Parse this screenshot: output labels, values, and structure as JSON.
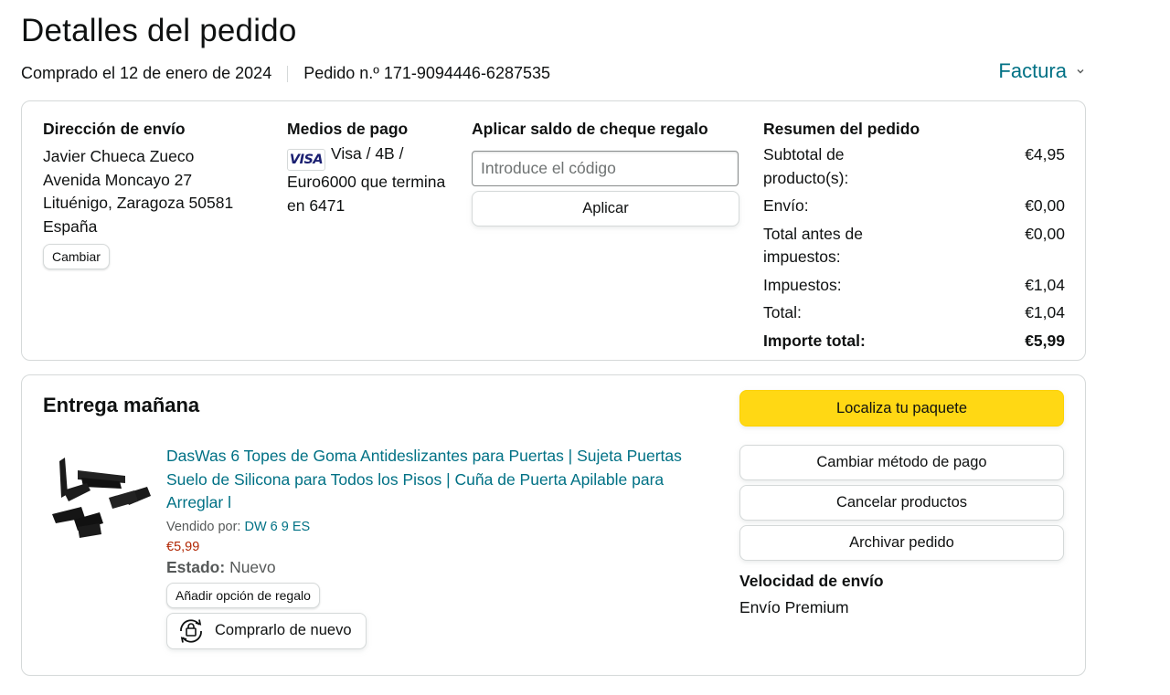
{
  "header": {
    "title": "Detalles del pedido",
    "purchase_date": "Comprado el 12 de enero de 2024",
    "order_number": "Pedido n.º 171-9094446-6287535",
    "invoice_label": "Factura"
  },
  "shipping": {
    "heading": "Dirección de envío",
    "name": "Javier Chueca Zueco",
    "street": "Avenida Moncayo 27",
    "city": "Lituénigo, Zaragoza 50581",
    "country": "España",
    "change_label": "Cambiar"
  },
  "payment": {
    "heading": "Medios de pago",
    "card_brand_logo": "VISA",
    "card_text_1": "Visa / 4B /",
    "card_text_2": "Euro6000 que termina en 6471"
  },
  "gift_card": {
    "heading": "Aplicar saldo de cheque regalo",
    "placeholder": "Introduce el código",
    "apply_label": "Aplicar"
  },
  "summary": {
    "heading": "Resumen del pedido",
    "rows": [
      {
        "label": "Subtotal de producto(s):",
        "value": "€4,95"
      },
      {
        "label": "Envío:",
        "value": "€0,00"
      },
      {
        "label": "Total antes de impuestos:",
        "value": "€0,00"
      },
      {
        "label": "Impuestos:",
        "value": "€1,04"
      },
      {
        "label": "Total:",
        "value": "€1,04"
      }
    ],
    "grand_total_label": "Importe total:",
    "grand_total_value": "€5,99"
  },
  "delivery": {
    "heading": "Entrega mañana",
    "product": {
      "title": "DasWas 6 Topes de Goma Antideslizantes para Puertas | Sujeta Puertas Suelo de Silicona para Todos los Pisos | Cuña de Puerta Apilable para Arreglar l",
      "seller_label": "Vendido por:",
      "seller_name": "DW 6 9 ES",
      "price": "€5,99",
      "condition_label": "Estado:",
      "condition_value": "Nuevo",
      "gift_option_label": "Añadir opción de regalo",
      "buy_again_label": "Comprarlo de nuevo"
    },
    "actions": {
      "track": "Localiza tu paquete",
      "change_payment": "Cambiar método de pago",
      "cancel": "Cancelar productos",
      "archive": "Archivar pedido"
    },
    "speed_heading": "Velocidad de envío",
    "speed_value": "Envío Premium"
  },
  "colors": {
    "link": "#007185",
    "price": "#b12704",
    "primary_button": "#ffd814",
    "border": "#d5d9d9"
  },
  "icons": [
    "chevron-down-icon",
    "visa-card-icon",
    "door-stopper-product-image",
    "buy-again-icon"
  ]
}
